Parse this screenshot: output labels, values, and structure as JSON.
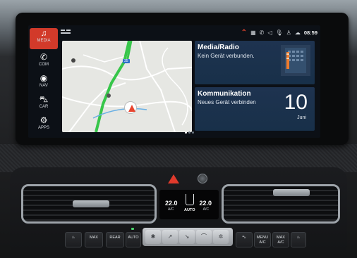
{
  "sidebar": {
    "items": [
      {
        "label": "MEDIA",
        "icon": "music-note-icon",
        "active": true
      },
      {
        "label": "COM",
        "icon": "phone-icon",
        "active": false
      },
      {
        "label": "NAV",
        "icon": "navigation-icon",
        "active": false
      },
      {
        "label": "CAR",
        "icon": "car-icon",
        "active": false
      },
      {
        "label": "APPS",
        "icon": "apps-icon",
        "active": false
      }
    ]
  },
  "statusbar": {
    "time": "08:59",
    "icons": [
      "chevron-up-icon",
      "keyboard-icon",
      "wifi-calling-icon",
      "navigation-arrow-icon",
      "microphone-icon",
      "user-profile-icon",
      "connected-drive-icon"
    ],
    "accent": "#e8452f"
  },
  "map": {
    "route_number": "35"
  },
  "media_widget": {
    "title": "Media/Radio",
    "subtitle": "Kein Gerät verbunden."
  },
  "communication_widget": {
    "title": "Kommunikation",
    "subtitle": "Neues Gerät verbinden",
    "day": "10",
    "month": "Juni"
  },
  "pager": {
    "pages": 3,
    "active": 0
  },
  "climate": {
    "temp_left": "22.0",
    "temp_right": "22.0",
    "ac_label_left": "A/C",
    "ac_label_right": "A/C",
    "auto_label": "AUTO"
  },
  "buttons": {
    "max_defrost": "MAX",
    "rear_defrost": "REAR",
    "auto": "AUTO",
    "menu": "MENU",
    "menu_sub": "A/C",
    "max_ac": "MAX",
    "max_ac_sub": "A/C"
  },
  "colors": {
    "brand_active": "#d23a2a",
    "widget_bg": "#1e3350",
    "map_route": "#37c64a"
  }
}
